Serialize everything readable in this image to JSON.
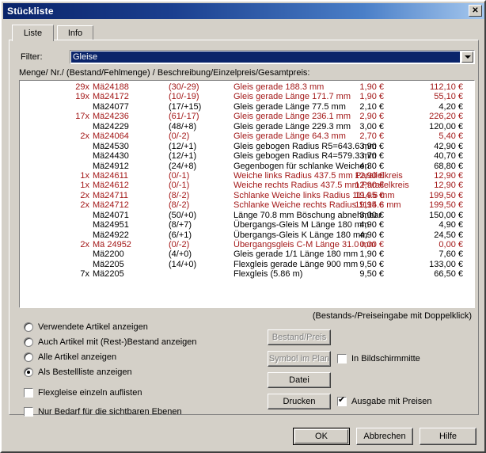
{
  "window": {
    "title": "Stückliste",
    "close_label": "✕"
  },
  "tabs": [
    {
      "label": "Liste",
      "active": true
    },
    {
      "label": "Info",
      "active": false
    }
  ],
  "filter": {
    "label": "Filter:",
    "value": "Gleise",
    "arrow_icon": "chevron-down-icon"
  },
  "list": {
    "columns_caption": "Menge/ Nr./ (Bestand/Fehlmenge) / Beschreibung/Einzelpreis/Gesamtpreis:",
    "highlight_color": "#a31818",
    "rows": [
      {
        "qty": "29x",
        "article": "Mä24188",
        "stock": "(30/-29)",
        "description": "Gleis gerade 188.3 mm",
        "unit": "1,90 €",
        "total": "112,10 €",
        "highlight": true
      },
      {
        "qty": "19x",
        "article": "Mä24172",
        "stock": "(10/-19)",
        "description": "Gleis gerade Länge 171.7 mm",
        "unit": "1,90 €",
        "total": "55,10 €",
        "highlight": true
      },
      {
        "qty": "",
        "article": "Mä24077",
        "stock": "(17/+15)",
        "description": "Gleis gerade Länge 77.5 mm",
        "unit": "2,10 €",
        "total": "4,20 €",
        "highlight": false
      },
      {
        "qty": "17x",
        "article": "Mä24236",
        "stock": "(61/-17)",
        "description": "Gleis gerade Länge 236.1 mm",
        "unit": "2,90 €",
        "total": "226,20 €",
        "highlight": true
      },
      {
        "qty": "",
        "article": "Mä24229",
        "stock": "(48/+8)",
        "description": "Gleis gerade Länge 229.3 mm",
        "unit": "3,00 €",
        "total": "120,00 €",
        "highlight": false
      },
      {
        "qty": "2x",
        "article": "Mä24064",
        "stock": "(0/-2)",
        "description": "Gleis gerade Länge 64.3 mm",
        "unit": "2,70 €",
        "total": "5,40 €",
        "highlight": true
      },
      {
        "qty": "",
        "article": "Mä24530",
        "stock": "(12/+1)",
        "description": "Gleis gebogen Radius R5=643.6 mm",
        "unit": "3,90 €",
        "total": "42,90 €",
        "highlight": false
      },
      {
        "qty": "",
        "article": "Mä24430",
        "stock": "(12/+1)",
        "description": "Gleis gebogen Radius R4=579.3 mm",
        "unit": "3,70 €",
        "total": "40,70 €",
        "highlight": false
      },
      {
        "qty": "",
        "article": "Mä24912",
        "stock": "(24/+8)",
        "description": "Gegenbogen für schlanke Weichen",
        "unit": "4,30 €",
        "total": "68,80 €",
        "highlight": false
      },
      {
        "qty": "1x",
        "article": "Mä24611",
        "stock": "(0/-1)",
        "description": "Weiche links Radius 437.5 mm Parallelkreis",
        "unit": "12,90 €",
        "total": "12,90 €",
        "highlight": true
      },
      {
        "qty": "1x",
        "article": "Mä24612",
        "stock": "(0/-1)",
        "description": "Weiche rechts Radius 437.5 mm Parallelkreis",
        "unit": "12,90 €",
        "total": "12,90 €",
        "highlight": true
      },
      {
        "qty": "2x",
        "article": "Mä24711",
        "stock": "(8/-2)",
        "description": "Schlanke Weiche links Radius 1114.6 mm",
        "unit": "19,95 €",
        "total": "199,50 €",
        "highlight": true
      },
      {
        "qty": "2x",
        "article": "Mä24712",
        "stock": "(8/-2)",
        "description": "Schlanke Weiche rechts Radius 1114.6 mm",
        "unit": "19,95 €",
        "total": "199,50 €",
        "highlight": true
      },
      {
        "qty": "",
        "article": "Mä24071",
        "stock": "(50/+0)",
        "description": "Länge 70.8 mm Böschung abnehmbar",
        "unit": "3,00 €",
        "total": "150,00 €",
        "highlight": false
      },
      {
        "qty": "",
        "article": "Mä24951",
        "stock": "(8/+7)",
        "description": "Übergangs-Gleis M Länge 180 mm",
        "unit": "4,90 €",
        "total": "4,90 €",
        "highlight": false
      },
      {
        "qty": "",
        "article": "Mä24922",
        "stock": "(6/+1)",
        "description": "Übergangs-Gleis K Länge 180 mm",
        "unit": "4,90 €",
        "total": "24,50 €",
        "highlight": false
      },
      {
        "qty": "2x",
        "article": "Mä 24952",
        "stock": "(0/-2)",
        "description": "Übergangsgleis C-M Länge 31.0 mm",
        "unit": "0,00 €",
        "total": "0,00 €",
        "highlight": true
      },
      {
        "qty": "",
        "article": "Mä2200",
        "stock": "(4/+0)",
        "description": "Gleis gerade 1/1 Länge 180 mm",
        "unit": "1,90 €",
        "total": "7,60 €",
        "highlight": false
      },
      {
        "qty": "",
        "article": "Mä2205",
        "stock": "(14/+0)",
        "description": "Flexgleis gerade Länge 900 mm",
        "unit": "9,50 €",
        "total": "133,00 €",
        "highlight": false
      },
      {
        "qty": "7x",
        "article": "Mä2205",
        "stock": "",
        "description": "Flexgleis (5.86 m)",
        "unit": "9,50 €",
        "total": "66,50 €",
        "highlight": false
      }
    ]
  },
  "hint": "(Bestands-/Preiseingabe mit Doppelklick)",
  "options": {
    "radios": [
      {
        "label": "Verwendete Artikel anzeigen",
        "checked": false
      },
      {
        "label": "Auch Artikel mit (Rest-)Bestand anzeigen",
        "checked": false
      },
      {
        "label": "Alle Artikel anzeigen",
        "checked": false
      },
      {
        "label": "Als Bestellliste anzeigen",
        "checked": true
      }
    ],
    "checkboxes": [
      {
        "label": "Flexgleise einzeln auflisten",
        "checked": false
      },
      {
        "label": "Nur Bedarf für die sichtbaren Ebenen",
        "checked": false
      }
    ]
  },
  "actions": {
    "bestand_preis": "Bestand/Preis",
    "symbol_im_plan": "Symbol im Plan",
    "datei": "Datei",
    "drucken": "Drucken",
    "in_bildschirmmitte": "In Bildschirmmitte",
    "in_bildschirmmitte_checked": false,
    "ausgabe_mit_preisen": "Ausgabe mit Preisen",
    "ausgabe_mit_preisen_checked": true
  },
  "footer": {
    "ok": "OK",
    "cancel": "Abbrechen",
    "help": "Hilfe"
  }
}
